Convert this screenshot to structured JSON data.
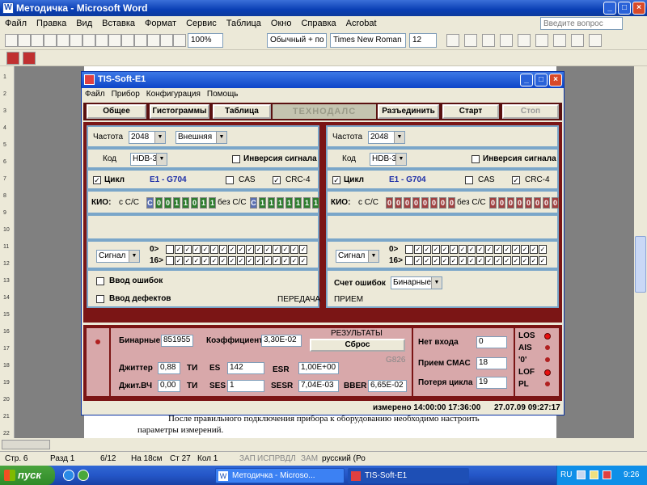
{
  "word": {
    "title": "Методичка - Microsoft Word",
    "menu": [
      "Файл",
      "Правка",
      "Вид",
      "Вставка",
      "Формат",
      "Сервис",
      "Таблица",
      "Окно",
      "Справка",
      "Acrobat"
    ],
    "help_placeholder": "Введите вопрос",
    "zoom": "100%",
    "style": "Обычный + по ц",
    "font": "Times New Roman",
    "size": "12",
    "ruler_numbers": [
      "1",
      "2",
      "3",
      "4",
      "5",
      "6",
      "7",
      "8",
      "9",
      "10",
      "11",
      "12",
      "13",
      "14",
      "15",
      "16",
      "17",
      "18",
      "19",
      "20",
      "21",
      "22"
    ],
    "doc_text_1": "После правильного подключения прибора к оборудованию необходимо настроить",
    "doc_text_2": "параметры измерений.",
    "status": {
      "page": "Стр. 6",
      "section": "Разд 1",
      "pages": "6/12",
      "at": "На 18см",
      "line": "Ст 27",
      "col": "Кол 1",
      "zap": "ЗАП",
      "ispr": "ИСПР",
      "vdl": "ВДЛ",
      "zam": "ЗАМ",
      "lang": "русский (Ро"
    }
  },
  "taskbar": {
    "start": "пуск",
    "tasks": [
      "Методичка - Microso...",
      "TIS-Soft-E1"
    ],
    "lang": "RU",
    "clock": "9:26"
  },
  "tis": {
    "title": "TIS-Soft-E1",
    "menu": [
      "Файл",
      "Прибор",
      "Конфигурация",
      "Помощь"
    ],
    "tabs": [
      "Общее",
      "Гистограммы",
      "Таблица"
    ],
    "brand": "ТЕХНОДАЛС",
    "buttons": {
      "disconnect": "Разъединить",
      "start": "Старт",
      "stop": "Стоп"
    },
    "tx": {
      "freq_label": "Частота",
      "freq": "2048",
      "clock": "Внешняя",
      "code_label": "Код",
      "code": "HDB-3",
      "invert": "Инверсия сигнала",
      "cycle": "Цикл",
      "cycle_std": "E1 - G704",
      "cas": "CAS",
      "crc": "CRC-4",
      "kio": "КИО:",
      "with": "с С/С",
      "without": "без С/С",
      "bits_with": [
        "C",
        "0",
        "0",
        "1",
        "1",
        "0",
        "1",
        "1"
      ],
      "bits_without": [
        "C",
        "1",
        "1",
        "1",
        "1",
        "1",
        "1",
        "1"
      ],
      "signal": "Сигнал",
      "r0": "0>",
      "r16": "16>",
      "err_in": "Ввод ошибок",
      "def_in": "Ввод дефектов",
      "dir": "ПЕРЕДАЧА"
    },
    "rx": {
      "freq_label": "Частота",
      "freq": "2048",
      "code_label": "Код",
      "code": "HDB-3",
      "invert": "Инверсия сигнала",
      "cycle": "Цикл",
      "cycle_std": "E1 - G704",
      "cas": "CAS",
      "crc": "CRC-4",
      "kio": "КИО:",
      "with": "с С/С",
      "without": "без С/С",
      "bits_with": [
        "0",
        "0",
        "0",
        "0",
        "0",
        "0",
        "0",
        "0"
      ],
      "bits_without": [
        "0",
        "0",
        "0",
        "0",
        "0",
        "0",
        "0",
        "0"
      ],
      "signal": "Сигнал",
      "r0": "0>",
      "r16": "16>",
      "err_count": "Счет ошибок",
      "err_mode": "Бинарные",
      "dir": "ПРИЕМ"
    },
    "results": {
      "binary_label": "Бинарные",
      "binary": "851955",
      "coef_label": "Коэффициент",
      "coef": "3,30E-02",
      "heading": "РЕЗУЛЬТАТЫ",
      "reset": "Сброс",
      "g826": "G826",
      "jitter_label": "Джиттер",
      "jitter": "0,88",
      "ti1": "ТИ",
      "jitter_hf_label": "Джит.ВЧ",
      "jitter_hf": "0,00",
      "ti2": "ТИ",
      "es_label": "ES",
      "es": "142",
      "esr_label": "ESR",
      "esr": "1,00E+00",
      "ses_label": "SES",
      "ses": "1",
      "sesr_label": "SESR",
      "sesr": "7,04E-03",
      "bber_label": "BBER",
      "bber": "6,65E-02",
      "no_input_label": "Нет входа",
      "no_input": "0",
      "smas_label": "Прием СМАС",
      "smas": "18",
      "loss_label": "Потеря цикла",
      "loss": "19",
      "alarms": [
        "LOS",
        "AIS",
        "'0'",
        "LOF",
        "PL"
      ]
    },
    "measured": "измерено 14:00:00 17:36:00",
    "datetime": "27.07.09 09:27:17"
  },
  "colors": {
    "led_on": "#e81010",
    "bit_blue": "#5a6fb0",
    "bit_green": "#2e7d2e",
    "bit_red": "#a04040"
  }
}
